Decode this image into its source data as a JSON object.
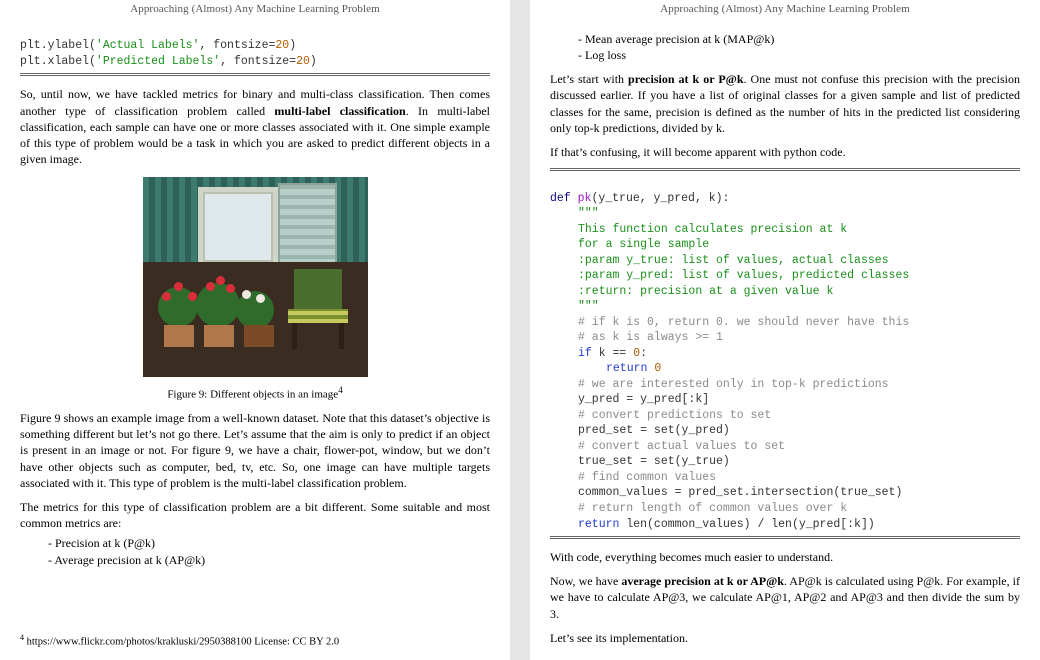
{
  "header": {
    "running_head": "Approaching (Almost) Any Machine Learning Problem"
  },
  "left": {
    "code_ylabel_pre": "plt.ylabel(",
    "code_ylabel_str": "'Actual Labels'",
    "code_ylabel_post": ", fontsize=",
    "code_ylabel_num": "20",
    "code_ylabel_end": ")",
    "code_xlabel_pre": "plt.xlabel(",
    "code_xlabel_str": "'Predicted Labels'",
    "code_xlabel_post": ", fontsize=",
    "code_xlabel_num": "20",
    "code_xlabel_end": ")",
    "para1_a": "So, until now, we have tackled metrics for binary and multi-class classification. Then comes another type of classification problem called ",
    "para1_bold": "multi-label classification",
    "para1_b": ". In multi-label classification, each sample can have one or more classes associated with it. One simple example of this type of problem would be a task in which you are asked to predict different objects in a given image.",
    "figure_caption_a": "Figure 9: Different objects in an image",
    "figure_caption_sup": "4",
    "para2": "Figure 9 shows an example image from a well-known dataset. Note that this dataset’s objective is something different but let’s not go there. Let’s assume that the aim is only to predict if an object is present in an image or not. For figure 9, we have a chair, flower-pot, window, but we don’t have other objects such as computer, bed, tv, etc. So, one image can have multiple targets associated with it. This type of problem is the multi-label classification problem.",
    "para3": "The metrics for this type of classification problem are a bit different. Some suitable and most common metrics are:",
    "bullets": [
      "Precision at k (P@k)",
      "Average precision at k (AP@k)"
    ],
    "footnote_sup": "4",
    "footnote_text": " https://www.flickr.com/photos/krakluski/2950388100 License: CC BY 2.0"
  },
  "right": {
    "bullets": [
      "Mean average precision at k (MAP@k)",
      "Log loss"
    ],
    "para1_a": "Let’s start with ",
    "para1_bold": "precision at k or P@k",
    "para1_b": ". One must not confuse this precision with the precision discussed earlier. If you have a list of original classes for a given sample and list of predicted classes for the same, precision is defined as the number of hits in the predicted list considering only top-k predictions, divided by k.",
    "para2": "If that’s confusing, it will become apparent with python code.",
    "code": {
      "l1_def": "def",
      "l1_fn": " pk",
      "l1_sig": "(y_true, y_pred, k):",
      "l2": "\"\"\"",
      "l3": "This function calculates precision at k",
      "l4": "for a single sample",
      "l5": ":param y_true: list of values, actual classes",
      "l6": ":param y_pred: list of values, predicted classes",
      "l7": ":return: precision at a given value k",
      "l8": "\"\"\"",
      "l9": "# if k is 0, return 0. we should never have this",
      "l10": "# as k is always >= 1",
      "l11_if": "if",
      "l11_rest": " k == ",
      "l11_num": "0",
      "l11_colon": ":",
      "l12_ret": "return",
      "l12_num": " 0",
      "l13": "# we are interested only in top-k predictions",
      "l14": "y_pred = y_pred[:k]",
      "l15": "# convert predictions to set",
      "l16": "pred_set = set(y_pred)",
      "l17": "# convert actual values to set",
      "l18": "true_set = set(y_true)",
      "l19": "# find common values",
      "l20": "common_values = pred_set.intersection(true_set)",
      "l21": "# return length of common values over k",
      "l22_ret": "return",
      "l22_rest": " len(common_values) / len(y_pred[:k])"
    },
    "para3": "With code, everything becomes much easier to understand.",
    "para4_a": "Now, we have ",
    "para4_bold": "average precision at k or AP@k",
    "para4_b": ". AP@k is calculated using P@k. For example, if we have to calculate AP@3, we calculate AP@1, AP@2 and AP@3 and then divide the sum by 3.",
    "para5": "Let’s see its implementation."
  }
}
